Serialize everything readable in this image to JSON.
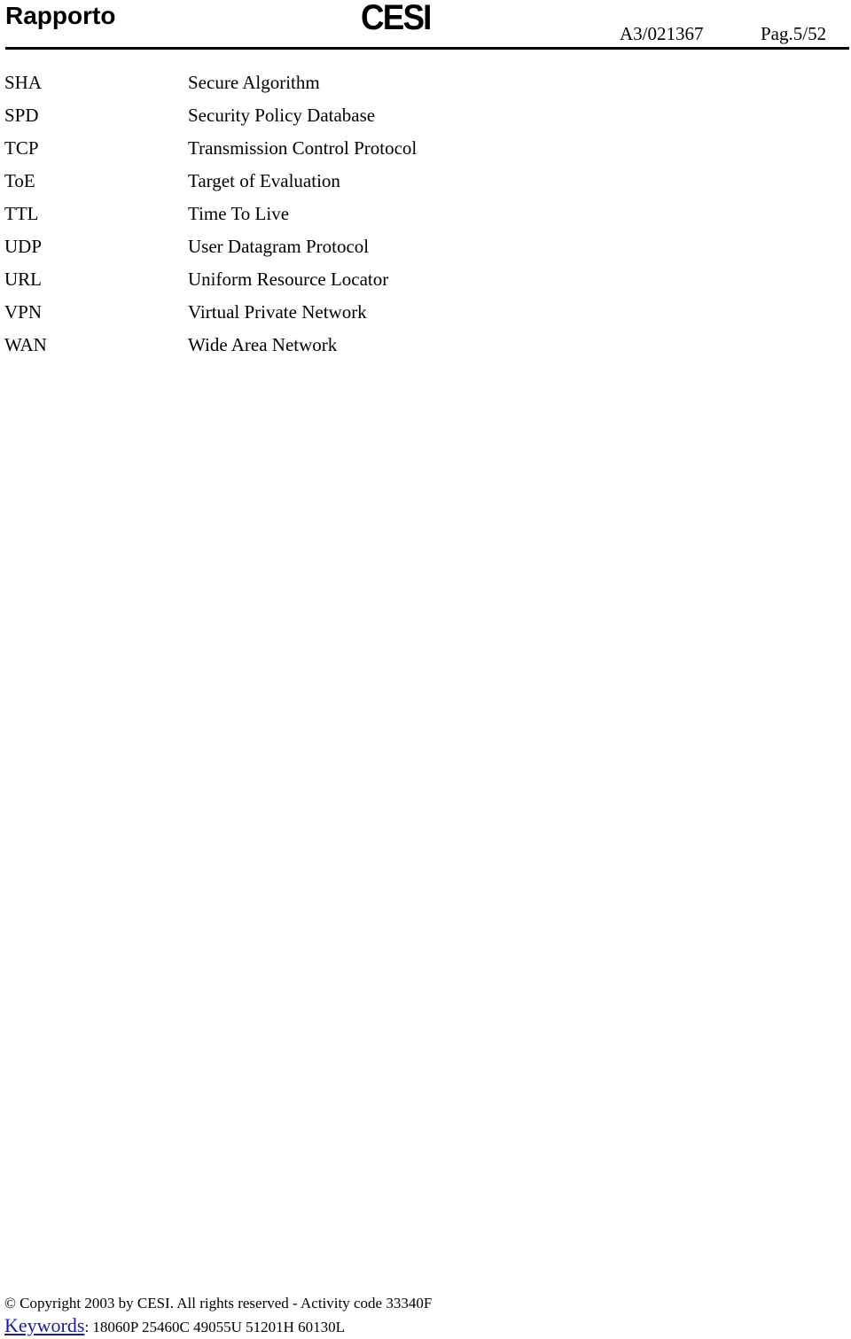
{
  "header": {
    "title": "Rapporto",
    "logo_text": "CESI",
    "document_number": "A3/021367",
    "page_label": "Pag.5/52"
  },
  "glossary": [
    {
      "abbr": "SHA",
      "definition": "Secure Algorithm"
    },
    {
      "abbr": "SPD",
      "definition": "Security Policy Database"
    },
    {
      "abbr": "TCP",
      "definition": "Transmission Control Protocol"
    },
    {
      "abbr": "ToE",
      "definition": "Target of Evaluation"
    },
    {
      "abbr": "TTL",
      "definition": "Time To Live"
    },
    {
      "abbr": "UDP",
      "definition": "User Datagram Protocol"
    },
    {
      "abbr": "URL",
      "definition": "Uniform Resource Locator"
    },
    {
      "abbr": "VPN",
      "definition": "Virtual Private Network"
    },
    {
      "abbr": "WAN",
      "definition": "Wide Area Network"
    }
  ],
  "footer": {
    "copyright": "© Copyright 2003 by CESI. All rights reserved - Activity code 33340F",
    "keywords_label": "Keywords",
    "keywords_separator": ":",
    "keywords_values": " 18060P 25460C 49055U 51201H 60130L",
    "link_color": "#1a1aa8"
  }
}
